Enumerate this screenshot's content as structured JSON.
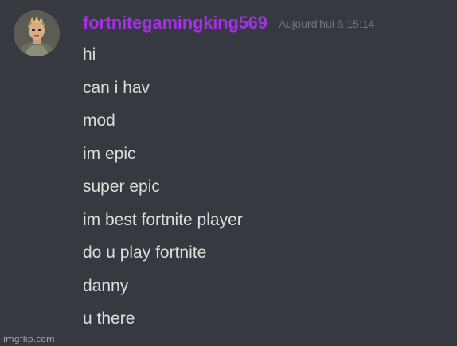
{
  "message_group": {
    "author": {
      "username": "fortnitegamingking569",
      "username_color": "#a32fe6"
    },
    "timestamp": "Aujourd'hui à 15:14",
    "messages": [
      "hi",
      "can i hav",
      "mod",
      "im epic",
      "super epic",
      "im best fortnite player",
      "do u play fortnite",
      "danny",
      "u there"
    ]
  },
  "watermark": "imgflip.com",
  "colors": {
    "background": "#36393f",
    "message_text": "#dcddde",
    "timestamp_text": "#72767d"
  },
  "icons": {
    "avatar": "fortnite-character-avatar"
  }
}
